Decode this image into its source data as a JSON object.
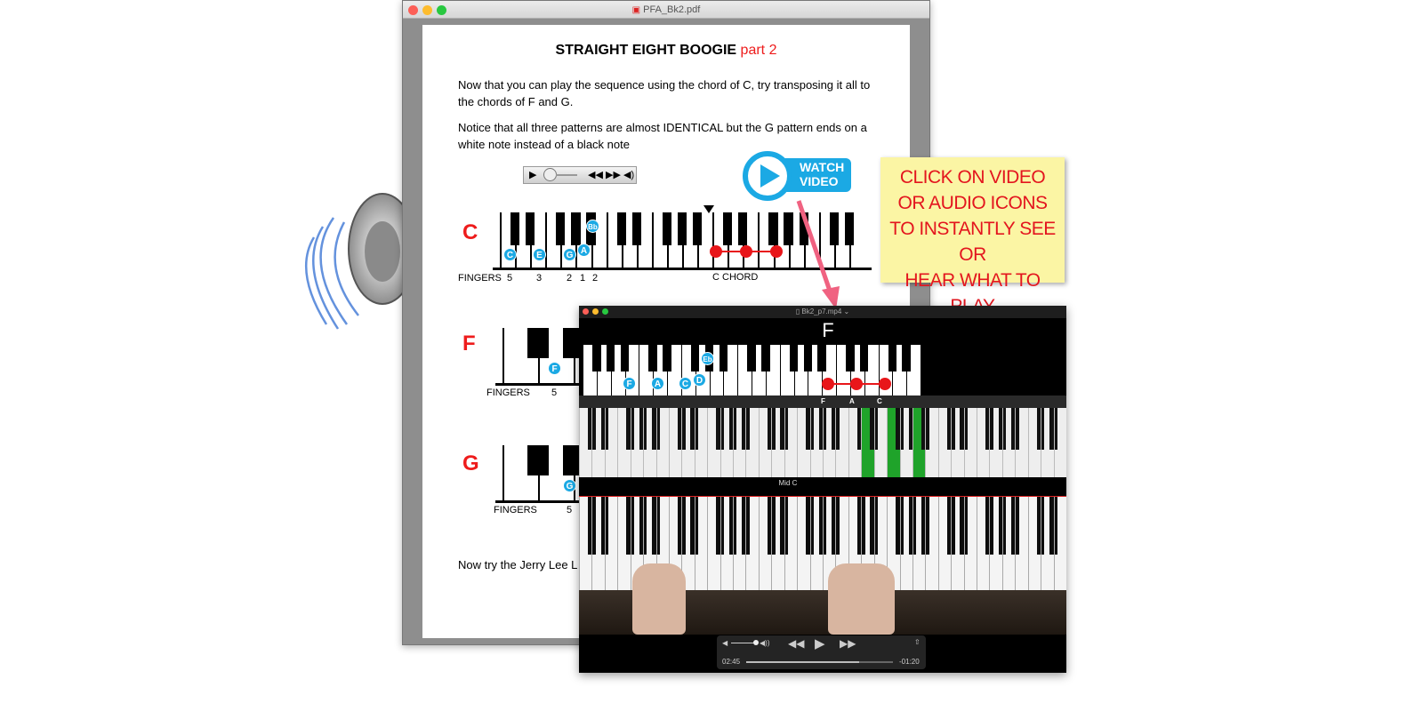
{
  "pdf_window": {
    "title": "PFA_Bk2.pdf",
    "file_icon": "pdf-file-icon"
  },
  "page": {
    "title": "STRAIGHT EIGHT BOOGIE",
    "title_suffix": "part 2",
    "paragraph1_line1": "Now that you can play the sequence using the chord of C, try transposing it all to",
    "paragraph1_line2": "the chords of F and G.",
    "paragraph2_line1": "Notice that all three patterns are almost IDENTICAL  but the G pattern ends on a",
    "paragraph2_line2": "white note instead of a black note",
    "sections": [
      {
        "chord": "C",
        "notes": [
          "C",
          "E",
          "G",
          "A",
          "Bb"
        ],
        "fingers_label": "FINGERS",
        "fingers": [
          "5",
          "3",
          "2",
          "1",
          "2"
        ],
        "chord_label": "C CHORD"
      },
      {
        "chord": "F",
        "notes": [
          "F"
        ],
        "fingers_label": "FINGERS",
        "fingers": [
          "5"
        ]
      },
      {
        "chord": "G",
        "notes": [
          "G"
        ],
        "fingers_label": "FINGERS",
        "fingers": [
          "5"
        ]
      }
    ],
    "footer_text": "Now try the Jerry Lee L"
  },
  "audio_controls": {
    "icons": [
      "play-icon",
      "slider",
      "step-back-icon",
      "step-forward-icon",
      "volume-icon"
    ]
  },
  "watch_video": {
    "line1": "WATCH",
    "line2": "VIDEO",
    "color": "#1ba9e4"
  },
  "callout": {
    "lines": [
      "CLICK ON VIDEO",
      "OR AUDIO ICONS",
      "TO INSTANTLY SEE OR",
      "HEAR WHAT TO PLAY"
    ],
    "color": "#e3151e",
    "bg": "#fbf5a4"
  },
  "video_window": {
    "title": "Bk2_p7.mp4",
    "chord": "F",
    "diagram_notes": [
      "F",
      "A",
      "C",
      "D",
      "Eb"
    ],
    "highlight_labels": [
      "F",
      "A",
      "C"
    ],
    "mid_c_label": "Mid C",
    "time_elapsed": "02:45",
    "time_remaining": "-01:20",
    "progress": 0.77
  }
}
